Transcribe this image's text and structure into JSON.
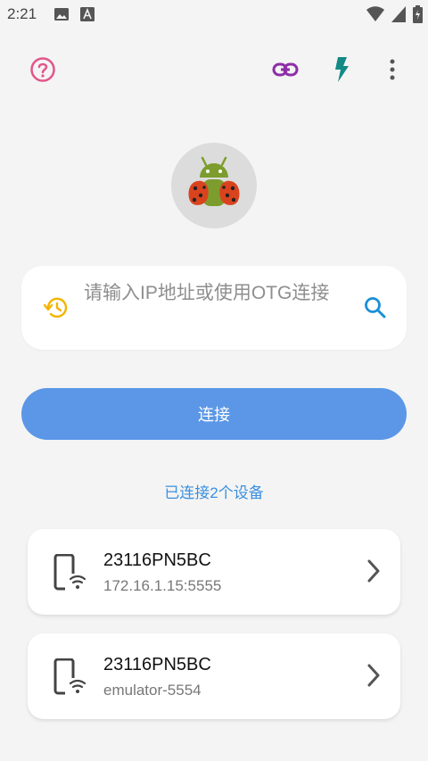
{
  "status_bar": {
    "time": "2:21",
    "icons": [
      "image-icon",
      "keyboard-a-icon",
      "wifi-icon",
      "signal-icon",
      "battery-icon"
    ]
  },
  "toolbar": {
    "icons": [
      "help-circle-icon",
      "link-icon",
      "flash-icon",
      "more-vert-icon"
    ],
    "colors": {
      "help": "#e2558a",
      "link": "#8e2ea8",
      "flash": "#128a86",
      "more": "#555555"
    }
  },
  "search": {
    "placeholder": "请输入IP地址或使用OTG连接",
    "colors": {
      "history_icon": "#f4b400",
      "search_icon": "#1a8fd6"
    }
  },
  "connect_button": {
    "label": "连接",
    "color": "#5b97e6"
  },
  "connected_summary": "已连接2个设备",
  "devices": [
    {
      "name": "23116PN5BC",
      "address": "172.16.1.15:5555"
    },
    {
      "name": "23116PN5BC",
      "address": "emulator-5554"
    }
  ]
}
